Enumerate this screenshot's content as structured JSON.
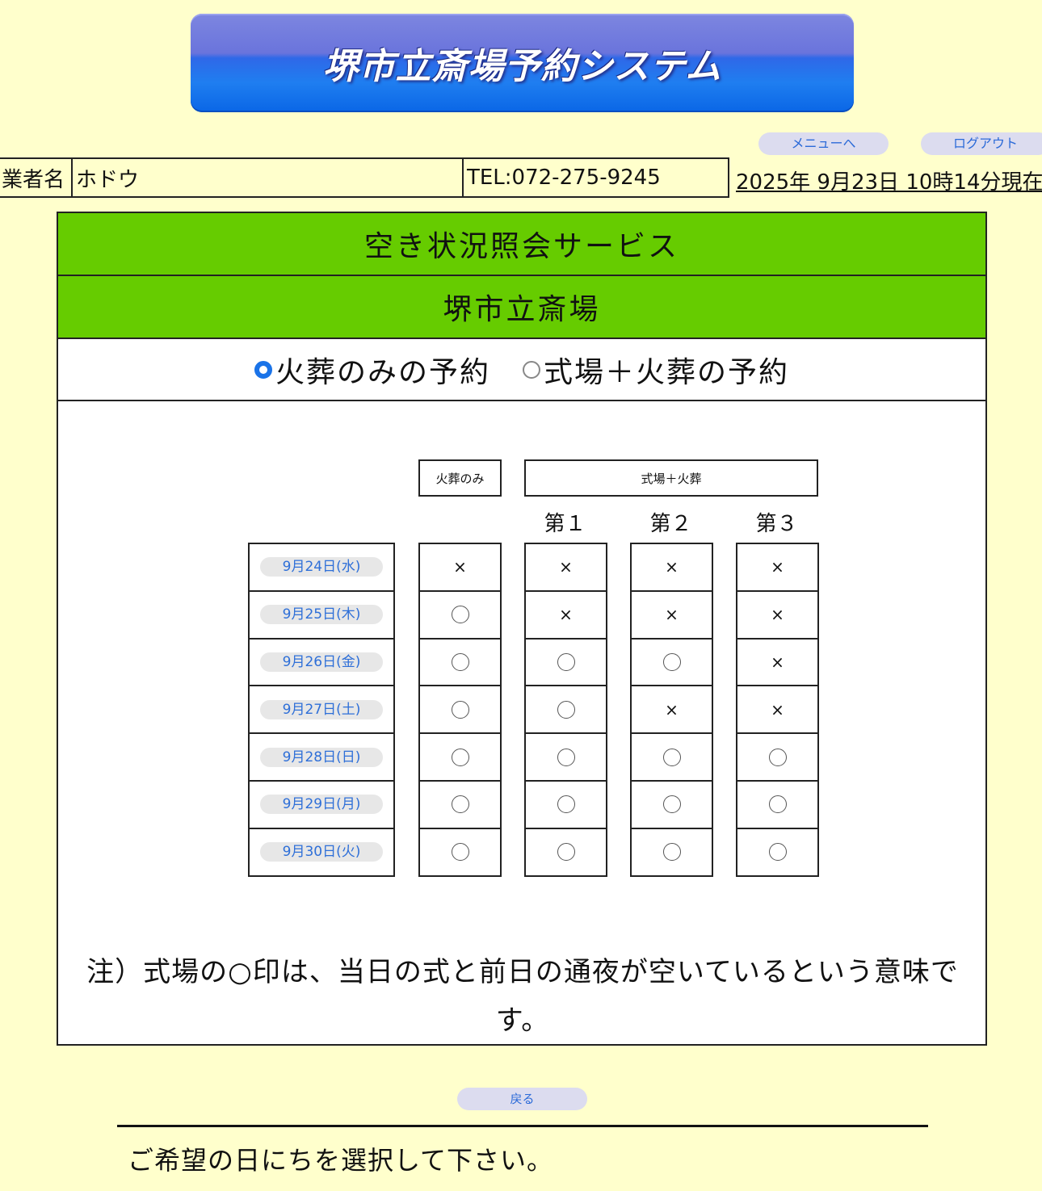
{
  "header": {
    "title": "堺市立斎場予約システム",
    "menu_button": "メニューへ",
    "logout_button": "ログアウト"
  },
  "info": {
    "vendor_label": "業者名",
    "vendor_name": "ホドウ",
    "tel": "TEL:072-275-9245",
    "datetime": "2025年 9月23日 10時14分現在"
  },
  "panel": {
    "service_title": "空き状況照会サービス",
    "facility_name": "堺市立斎場",
    "radio_options": [
      {
        "label": "火葬のみの予約",
        "selected": true
      },
      {
        "label": "式場＋火葬の予約",
        "selected": false
      }
    ]
  },
  "table": {
    "col_cremation_only": "火葬のみ",
    "col_hall_cremation": "式場＋火葬",
    "halls": [
      "第１",
      "第２",
      "第３"
    ],
    "rows": [
      {
        "date": "9月24日(水)",
        "cremation": "×",
        "hall1": "×",
        "hall2": "×",
        "hall3": "×"
      },
      {
        "date": "9月25日(木)",
        "cremation": "○",
        "hall1": "×",
        "hall2": "×",
        "hall3": "×"
      },
      {
        "date": "9月26日(金)",
        "cremation": "○",
        "hall1": "○",
        "hall2": "○",
        "hall3": "×"
      },
      {
        "date": "9月27日(土)",
        "cremation": "○",
        "hall1": "○",
        "hall2": "×",
        "hall3": "×"
      },
      {
        "date": "9月28日(日)",
        "cremation": "○",
        "hall1": "○",
        "hall2": "○",
        "hall3": "○"
      },
      {
        "date": "9月29日(月)",
        "cremation": "○",
        "hall1": "○",
        "hall2": "○",
        "hall3": "○"
      },
      {
        "date": "9月30日(火)",
        "cremation": "○",
        "hall1": "○",
        "hall2": "○",
        "hall3": "○"
      }
    ]
  },
  "note": "注）式場の○印は、当日の式と前日の通夜が空いているという意味です。",
  "back_button": "戻る",
  "footer_message": "ご希望の日にちを選択して下さい。"
}
